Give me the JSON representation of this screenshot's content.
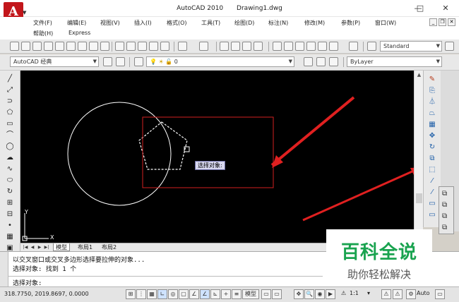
{
  "window": {
    "app_name": "AutoCAD 2010",
    "document_name": "Drawing1.dwg",
    "logo_letter": "A",
    "minimize": "—",
    "maximize": "□",
    "close": "✕"
  },
  "menu": {
    "items": [
      "文件(F)",
      "编辑(E)",
      "视图(V)",
      "插入(I)",
      "格式(O)",
      "工具(T)",
      "绘图(D)",
      "标注(N)",
      "修改(M)",
      "参数(P)",
      "窗口(W)"
    ],
    "row2": [
      "帮助(H)",
      "Express"
    ],
    "mdi": [
      "_",
      "❐",
      "✕"
    ]
  },
  "toolbars": {
    "text_style": "Standard",
    "workspace": "AutoCAD 经典",
    "layer": "0",
    "linetype": "ByLayer"
  },
  "canvas": {
    "tooltip": "选择对象:",
    "ucs_y": "Y",
    "ucs_x": "X"
  },
  "tabs": {
    "nav": [
      "|◀",
      "◀",
      "▶",
      "▶|"
    ],
    "model": "模型",
    "layout1": "布局1",
    "layout2": "布局2"
  },
  "command": {
    "line1": "以交叉窗口或交叉多边形选择要拉伸的对象...",
    "line2": "选择对象: 找到 1 个",
    "prompt": "选择对象:"
  },
  "status": {
    "coords": "318.7750,    2019.8697, 0.0000",
    "model_label": "模型",
    "scale": "1:1",
    "auto": "Auto"
  },
  "watermark": {
    "title": "百科全说",
    "subtitle": "助你轻松解决"
  },
  "colors": {
    "canvas_bg": "#000000",
    "selection_window": "#d21f1f",
    "circle": "#ffffff",
    "pentagon_dashed": "#ffffff",
    "annotation_arrow": "#e02020",
    "watermark_green": "#19a34f"
  }
}
